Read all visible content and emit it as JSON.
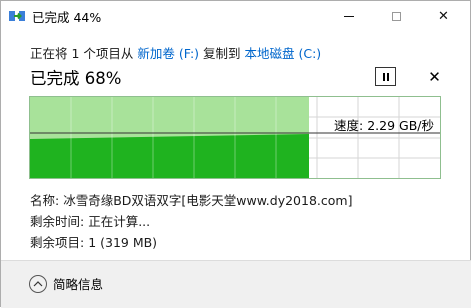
{
  "window": {
    "title": "已完成 44%"
  },
  "copy": {
    "prefix": "正在将 1 个项目从 ",
    "source": "新加卷 (F:)",
    "middle": " 复制到 ",
    "destination": "本地磁盘 (C:)",
    "status": "已完成 68%",
    "progress": 0.68
  },
  "graph": {
    "speed": "速度: 2.29 GB/秒"
  },
  "details": {
    "name_label": "名称: ",
    "name_value": "冰雪奇缘BD双语双字[电影天堂www.dy2018.com]",
    "time_label": "剩余时间: ",
    "time_value": "正在计算...",
    "items_label": "剩余项目: ",
    "items_value": "1 (319 MB)"
  },
  "footer": {
    "less_info": "简略信息"
  },
  "colors": {
    "progress_light": "#a8e29a",
    "progress_dark": "#1fb31f",
    "link": "#0066cc"
  },
  "icons": {
    "title": "copy-arrow-icon",
    "minimize": "minimize-icon",
    "maximize": "maximize-icon",
    "close": "close-icon",
    "pause": "pause-icon",
    "cancel": "cancel-icon",
    "chevron": "chevron-up-icon"
  }
}
